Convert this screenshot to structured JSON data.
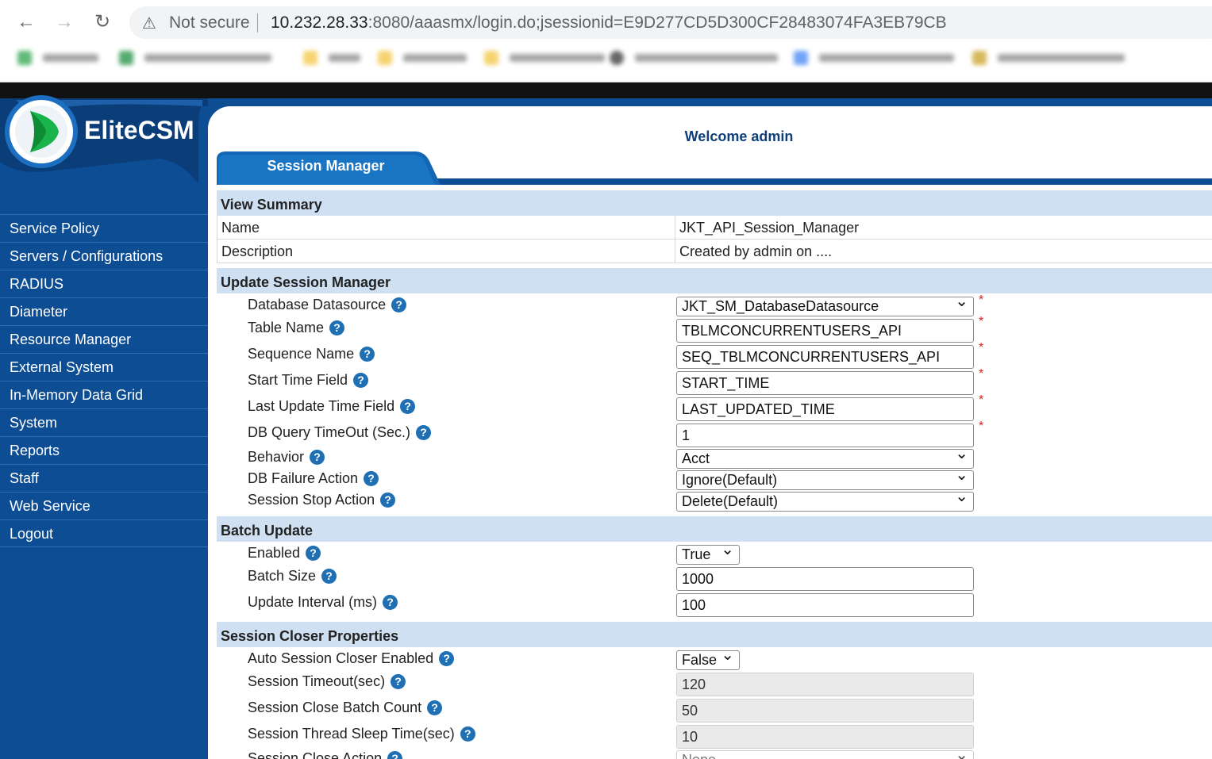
{
  "browser": {
    "security_label": "Not secure",
    "url_host": "10.232.28.33",
    "url_rest": ":8080/aaasmx/login.do;jsessionid=E9D277CD5D300CF28483074FA3EB79CB"
  },
  "app": {
    "logo_text": "EliteCSM",
    "welcome": "Welcome admin",
    "tab_label": "Session Manager",
    "menu": [
      "Service Policy",
      "Servers / Configurations",
      "RADIUS",
      "Diameter",
      "Resource Manager",
      "External System",
      "In-Memory Data Grid",
      "System",
      "Reports",
      "Staff",
      "Web Service",
      "Logout"
    ]
  },
  "summary": {
    "title": "View Summary",
    "name_label": "Name",
    "name_value": "JKT_API_Session_Manager",
    "desc_label": "Description",
    "desc_value": "Created by admin on ...."
  },
  "update": {
    "title": "Update Session Manager",
    "fields": [
      {
        "label": "Database Datasource",
        "value": "JKT_SM_DatabaseDatasource",
        "type": "select",
        "required": true
      },
      {
        "label": "Table Name",
        "value": "TBLMCONCURRENTUSERS_API",
        "type": "input",
        "required": true
      },
      {
        "label": "Sequence Name",
        "value": "SEQ_TBLMCONCURRENTUSERS_API",
        "type": "input",
        "required": true
      },
      {
        "label": "Start Time Field",
        "value": "START_TIME",
        "type": "input",
        "required": true
      },
      {
        "label": "Last Update Time Field",
        "value": "LAST_UPDATED_TIME",
        "type": "input",
        "required": true
      },
      {
        "label": "DB Query TimeOut (Sec.)",
        "value": "1",
        "type": "input",
        "required": true
      },
      {
        "label": "Behavior",
        "value": "Acct",
        "type": "select",
        "required": false
      },
      {
        "label": "DB Failure Action",
        "value": "Ignore(Default)",
        "type": "select",
        "required": false
      },
      {
        "label": "Session Stop Action",
        "value": "Delete(Default)",
        "type": "select",
        "required": false
      }
    ]
  },
  "batch": {
    "title": "Batch Update",
    "fields": [
      {
        "label": "Enabled",
        "value": "True",
        "type": "small"
      },
      {
        "label": "Batch Size",
        "value": "1000",
        "type": "input"
      },
      {
        "label": "Update Interval (ms)",
        "value": "100",
        "type": "input"
      }
    ]
  },
  "closer": {
    "title": "Session Closer Properties",
    "fields": [
      {
        "label": "Auto Session Closer Enabled",
        "value": "False",
        "type": "small"
      },
      {
        "label": "Session Timeout(sec)",
        "value": "120",
        "type": "disabled"
      },
      {
        "label": "Session Close Batch Count",
        "value": "50",
        "type": "disabled"
      },
      {
        "label": "Session Thread Sleep Time(sec)",
        "value": "10",
        "type": "disabled"
      },
      {
        "label": "Session Close Action",
        "value": "None",
        "type": "dselect"
      }
    ]
  },
  "colors": {
    "brand_blue": "#0d4d94",
    "section_bg": "#cfe0f3",
    "required": "#e02020",
    "help": "#1f6fb5"
  },
  "icons": {
    "back": "arrow-left-icon",
    "forward": "arrow-right-icon",
    "reload": "reload-icon",
    "warning": "warning-icon",
    "help": "help-circle-icon",
    "dropdown": "chevron-down-icon"
  }
}
